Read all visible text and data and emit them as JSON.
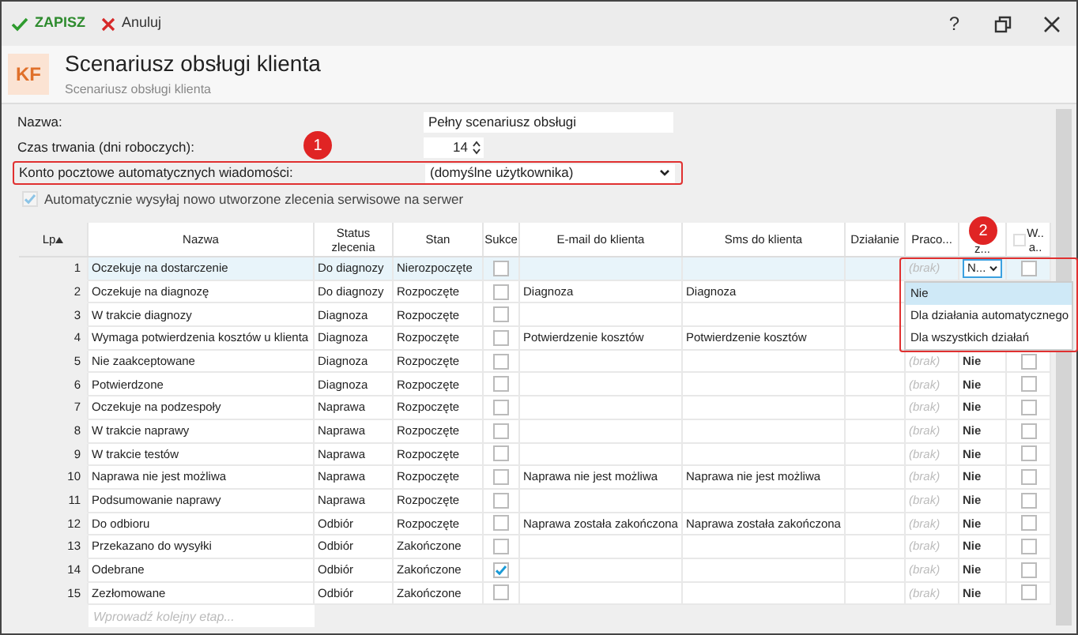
{
  "toolbar": {
    "save": "ZAPISZ",
    "cancel": "Anuluj",
    "help": "?"
  },
  "header": {
    "logo": "KF",
    "title": "Scenariusz obsługi klienta",
    "subtitle": "Scenariusz obsługi klienta"
  },
  "form": {
    "name": {
      "label": "Nazwa:",
      "value": "Pełny scenariusz obsługi"
    },
    "duration": {
      "label": "Czas trwania (dni roboczych):",
      "value": "14"
    },
    "mail_account": {
      "label": "Konto pocztowe automatycznych wiadomości:",
      "value": "(domyślne użytkownika)",
      "highlighted": true
    },
    "auto_send": {
      "label": "Automatycznie wysyłaj nowo utworzone zlecenia serwisowe na serwer",
      "checked": true,
      "disabled": true
    }
  },
  "annotations": [
    {
      "number": "1"
    },
    {
      "number": "2"
    }
  ],
  "table": {
    "columns": [
      "Lp",
      "Nazwa",
      "Status zlecenia",
      "Stan",
      "Sukce",
      "E-mail do klienta",
      "Sms do klienta",
      "Działanie",
      "Praco...",
      "z...",
      "W..\na.."
    ],
    "rows": [
      {
        "lp": "1",
        "name": "Oczekuje na dostarczenie",
        "status": "Do diagnozy",
        "state": "Nierozpoczęte",
        "success": false,
        "praco": "(brak)",
        "column_10": "N...",
        "column_11": false,
        "selected": true
      },
      {
        "lp": "2",
        "name": "Oczekuje na diagnozę",
        "status": "Do diagnozy",
        "state": "Rozpoczęte",
        "success": false,
        "email": "Diagnoza",
        "sms": "Diagnoza",
        "selected": false
      },
      {
        "lp": "3",
        "name": "W trakcie diagnozy",
        "status": "Diagnoza",
        "state": "Rozpoczęte",
        "success": false,
        "selected": false
      },
      {
        "lp": "4",
        "name": "Wymaga potwierdzenia kosztów u klienta",
        "status": "Diagnoza",
        "state": "Rozpoczęte",
        "success": false,
        "email": "Potwierdzenie kosztów",
        "sms": "Potwierdzenie kosztów",
        "selected": false
      },
      {
        "lp": "5",
        "name": "Nie zaakceptowane",
        "status": "Diagnoza",
        "state": "Rozpoczęte",
        "success": false,
        "praco": "(brak)",
        "column_10": "Nie",
        "column_11": false,
        "selected": false
      },
      {
        "lp": "6",
        "name": "Potwierdzone",
        "status": "Diagnoza",
        "state": "Rozpoczęte",
        "success": false,
        "praco": "(brak)",
        "column_10": "Nie",
        "column_11": false,
        "selected": false
      },
      {
        "lp": "7",
        "name": "Oczekuje na podzespoły",
        "status": "Naprawa",
        "state": "Rozpoczęte",
        "success": false,
        "praco": "(brak)",
        "column_10": "Nie",
        "column_11": false,
        "selected": false
      },
      {
        "lp": "8",
        "name": "W trakcie naprawy",
        "status": "Naprawa",
        "state": "Rozpoczęte",
        "success": false,
        "praco": "(brak)",
        "column_10": "Nie",
        "column_11": false,
        "selected": false
      },
      {
        "lp": "9",
        "name": "W trakcie testów",
        "status": "Naprawa",
        "state": "Rozpoczęte",
        "success": false,
        "praco": "(brak)",
        "column_10": "Nie",
        "column_11": false,
        "selected": false
      },
      {
        "lp": "10",
        "name": "Naprawa nie jest możliwa",
        "status": "Naprawa",
        "state": "Rozpoczęte",
        "success": false,
        "email": "Naprawa nie jest możliwa",
        "sms": "Naprawa nie jest możliwa",
        "praco": "(brak)",
        "column_10": "Nie",
        "column_11": false,
        "selected": false
      },
      {
        "lp": "11",
        "name": "Podsumowanie naprawy",
        "status": "Naprawa",
        "state": "Rozpoczęte",
        "success": false,
        "praco": "(brak)",
        "column_10": "Nie",
        "column_11": false,
        "selected": false
      },
      {
        "lp": "12",
        "name": "Do odbioru",
        "status": "Odbiór",
        "state": "Rozpoczęte",
        "success": false,
        "email": "Naprawa została zakończona",
        "sms": "Naprawa została zakończona",
        "praco": "(brak)",
        "column_10": "Nie",
        "column_11": false,
        "selected": false
      },
      {
        "lp": "13",
        "name": "Przekazano do wysyłki",
        "status": "Odbiór",
        "state": "Zakończone",
        "success": false,
        "praco": "(brak)",
        "column_10": "Nie",
        "column_11": false,
        "selected": false
      },
      {
        "lp": "14",
        "name": "Odebrane",
        "status": "Odbiór",
        "state": "Zakończone",
        "success": true,
        "praco": "(brak)",
        "column_10": "Nie",
        "column_11": false,
        "selected": false
      },
      {
        "lp": "15",
        "name": "Zezłomowane",
        "status": "Odbiór",
        "state": "Zakończone",
        "success": false,
        "praco": "(brak)",
        "column_10": "Nie",
        "column_11": false,
        "selected": false
      }
    ],
    "new_row_placeholder": "Wprowadź kolejny etap...",
    "select_all_checked": false
  },
  "dropdown": {
    "options": [
      {
        "label": "Nie",
        "selected": true
      },
      {
        "label": "Dla działania automatycznego",
        "selected": false
      },
      {
        "label": "Dla wszystkich działań",
        "selected": false
      }
    ]
  }
}
